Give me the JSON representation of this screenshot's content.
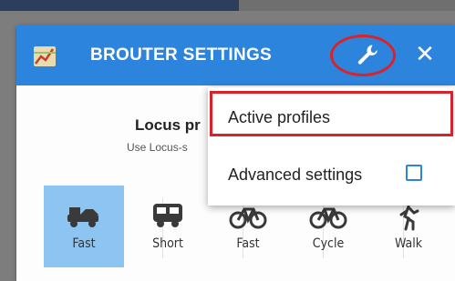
{
  "dialog": {
    "title": "BROUTER SETTINGS",
    "close_label": "✕",
    "profile_title": "Locus pr",
    "profile_subtitle": "Use Locus-s"
  },
  "icons": {
    "app": "map-app-icon",
    "settings": "wrench-icon",
    "close": "close-icon"
  },
  "menu": {
    "items": [
      {
        "label": "Active profiles"
      },
      {
        "label": "Advanced settings",
        "checkbox": false
      }
    ]
  },
  "profiles": [
    {
      "label": "Fast",
      "icon": "car-icon",
      "selected": true
    },
    {
      "label": "Short",
      "icon": "bus-icon",
      "selected": false
    },
    {
      "label": "Fast",
      "icon": "bicycle-icon",
      "selected": false
    },
    {
      "label": "Cycle",
      "icon": "bicycle-icon",
      "selected": false
    },
    {
      "label": "Walk",
      "icon": "walk-icon",
      "selected": false
    }
  ],
  "colors": {
    "header": "#2d84dd",
    "selected_profile": "#8ec4f1",
    "highlight": "#d8232a"
  }
}
